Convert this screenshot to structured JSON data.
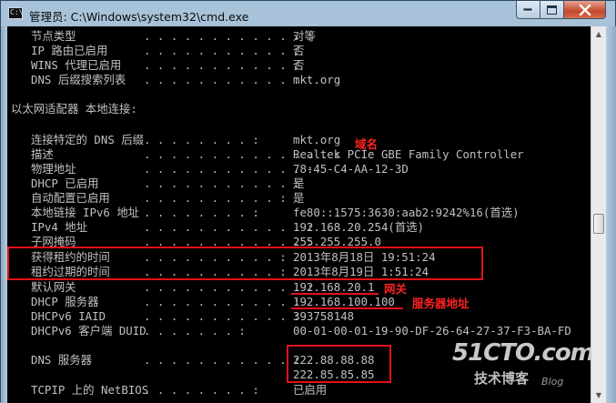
{
  "window": {
    "title": "管理员: C:\\Windows\\system32\\cmd.exe",
    "icon_text": "C:\\",
    "buttons": {
      "minimize": "—",
      "maximize": "☐",
      "close": "✕"
    }
  },
  "console": {
    "lines": [
      {
        "label": "节点类型",
        "dots": ". . . . . . . . . . . . :",
        "value": "对等"
      },
      {
        "label": "IP 路由已启用",
        "dots": ". . . . . . . . . . . :",
        "value": "否"
      },
      {
        "label": "WINS 代理已启用",
        "dots": ". . . . . . . . . . . :",
        "value": "否"
      },
      {
        "label": "DNS 后缀搜索列表",
        "dots": ". . . . . . . . . . . :",
        "value": "mkt.org"
      },
      {
        "header": "以太网适配器 本地连接:"
      },
      {
        "label": "连接特定的 DNS 后缀",
        "dots": ". . . . . . . . :",
        "value": "mkt.org"
      },
      {
        "label": "描述",
        "dots": ". . . . . . . . . . . . . . :",
        "value": "Realtek PCIe GBE Family Controller"
      },
      {
        "label": "物理地址",
        "dots": ". . . . . . . . . . . . :",
        "value": "78-45-C4-AA-12-3D"
      },
      {
        "label": "DHCP 已启用",
        "dots": ". . . . . . . . . . . :",
        "value": "是"
      },
      {
        "label": "自动配置已启用",
        "dots": ". . . . . . . . . . :",
        "value": "是"
      },
      {
        "label": "本地链接 IPv6 地址",
        "dots": ". . . . . . . . :",
        "value": "fe80::1575:3630:aab2:9242%16(首选)"
      },
      {
        "label": "IPv4 地址",
        "dots": ". . . . . . . . . . . . :",
        "value": "192.168.20.254(首选)"
      },
      {
        "label": "子网掩码",
        "dots": ". . . . . . . . . . . . :",
        "value": "255.255.255.0"
      },
      {
        "label": "获得租约的时间",
        "dots": ". . . . . . . . . . :",
        "value": "2013年8月18日 19:51:24"
      },
      {
        "label": "租约过期的时间",
        "dots": ". . . . . . . . . . :",
        "value": "2013年8月19日 1:51:24"
      },
      {
        "label": "默认网关",
        "dots": ". . . . . . . . . . . . :",
        "value": "192.168.20.1"
      },
      {
        "label": "DHCP 服务器",
        "dots": ". . . . . . . . . . . :",
        "value": "192.168.100.100"
      },
      {
        "label": "DHCPv6 IAID",
        "dots": ". . . . . . . . . . . :",
        "value": "393758148"
      },
      {
        "label": "DHCPv6 客户端 DUID",
        "dots": ". . . . . . . :",
        "value": "00-01-00-01-19-90-DF-26-64-27-37-F3-BA-FD"
      },
      {
        "label": "DNS 服务器",
        "dots": ". . . . . . . . . . . :",
        "value": "222.88.88.88"
      },
      {
        "value": "222.85.85.85"
      },
      {
        "label": "TCPIP 上的 NetBIOS",
        "dots": ". . . . . . . . :",
        "value": "已启用"
      }
    ]
  },
  "annotations": {
    "domain": "域名",
    "gateway": "网关",
    "dhcp_server": "服务器地址"
  },
  "watermark": {
    "logo": "51CTO.com",
    "sub": "技术博客",
    "blog": "Blog"
  },
  "scrollbar": {
    "up": "▲",
    "down": "▼"
  }
}
